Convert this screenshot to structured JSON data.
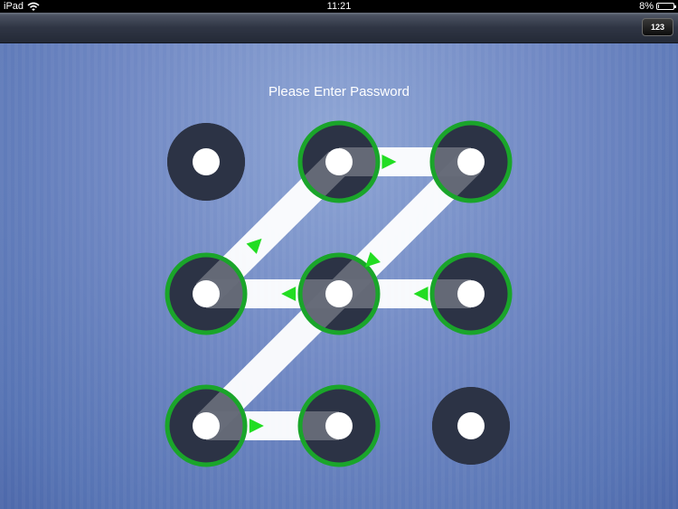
{
  "status_bar": {
    "device": "iPad",
    "time": "11:21",
    "battery_percent": "8%",
    "battery_level": 0.08,
    "wifi_icon": "wifi-icon",
    "battery_icon": "battery-icon"
  },
  "toolbar": {
    "keypad_label": "123"
  },
  "main": {
    "prompt": "Please Enter Password"
  },
  "pattern": {
    "grid": [
      {
        "id": 1,
        "row": 0,
        "col": 0,
        "selected": false
      },
      {
        "id": 2,
        "row": 0,
        "col": 1,
        "selected": true
      },
      {
        "id": 3,
        "row": 0,
        "col": 2,
        "selected": true
      },
      {
        "id": 4,
        "row": 1,
        "col": 0,
        "selected": true
      },
      {
        "id": 5,
        "row": 1,
        "col": 1,
        "selected": true
      },
      {
        "id": 6,
        "row": 1,
        "col": 2,
        "selected": true
      },
      {
        "id": 7,
        "row": 2,
        "col": 0,
        "selected": true
      },
      {
        "id": 8,
        "row": 2,
        "col": 1,
        "selected": true
      },
      {
        "id": 9,
        "row": 2,
        "col": 2,
        "selected": false
      }
    ],
    "sequence": [
      6,
      5,
      4,
      2,
      3,
      7,
      8
    ],
    "colors": {
      "node_fill": "#2c3345",
      "node_center": "#ffffff",
      "selected_ring": "#1aa52a",
      "arrow": "#22dd22",
      "connector": "#ffffff"
    }
  }
}
